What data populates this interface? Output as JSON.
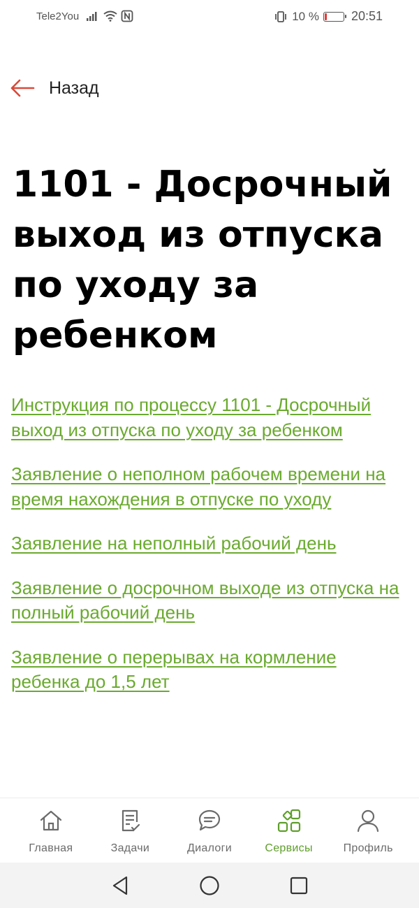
{
  "status_bar": {
    "carrier": "Tele2You",
    "battery_text": "10 %",
    "battery_level": 0.1,
    "time": "20:51",
    "battery_color": "#e53935"
  },
  "header": {
    "back_label": "Назад",
    "back_icon": "arrow-left-icon",
    "back_icon_color": "#d84a3a"
  },
  "page": {
    "title": "1101 - Досрочный выход из отпуска по уходу за ребенком"
  },
  "links": [
    "Инструкция по процессу 1101 - Досрочный выход из отпуска по уходу за ребенком",
    "Заявление о неполном рабочем времени на время нахождения в отпуске по уходу",
    "Заявление на неполный рабочий день",
    "Заявление о досрочном выходе из отпуска на полный рабочий день",
    "Заявление о перерывах на кормление ребенка до 1,5 лет"
  ],
  "link_color": "#6aaa2e",
  "bottom_nav": {
    "items": [
      {
        "label": "Главная",
        "icon": "home-icon",
        "active": false
      },
      {
        "label": "Задачи",
        "icon": "tasks-icon",
        "active": false
      },
      {
        "label": "Диалоги",
        "icon": "chat-icon",
        "active": false
      },
      {
        "label": "Сервисы",
        "icon": "services-icon",
        "active": true
      },
      {
        "label": "Профиль",
        "icon": "profile-icon",
        "active": false
      }
    ],
    "active_color": "#5e9e2a"
  },
  "system_nav": {
    "icons": [
      "back-triangle-icon",
      "home-circle-icon",
      "recents-square-icon"
    ]
  }
}
